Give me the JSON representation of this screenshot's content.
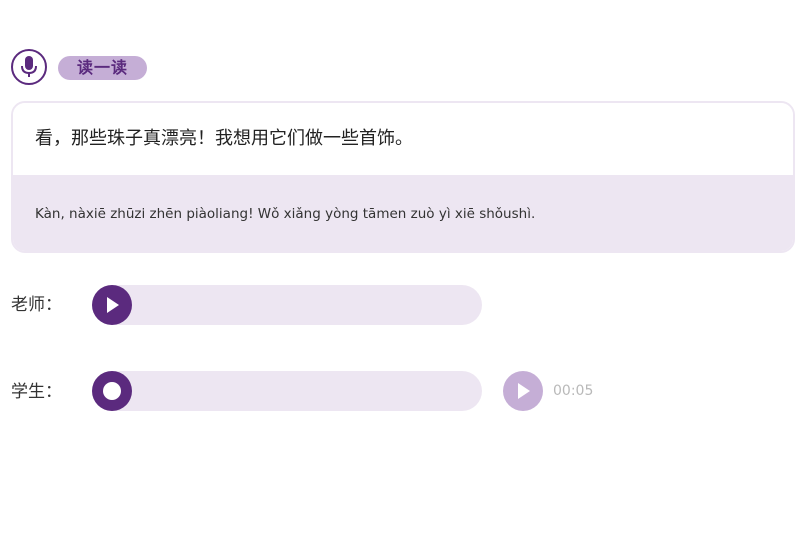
{
  "header": {
    "mic_icon": "microphone-icon",
    "badge_label": "读一读"
  },
  "card": {
    "hanzi": "看，那些珠子真漂亮！我想用它们做一些首饰。",
    "pinyin": "Kàn, nàxiē zhūzi zhēn piàoliang! Wǒ xiǎng yòng tāmen zuò yì xiē shǒushì."
  },
  "teacher": {
    "label": "老师：",
    "play_icon": "play-icon"
  },
  "student": {
    "label": "学生：",
    "record_icon": "record-icon",
    "playback_icon": "play-icon",
    "duration": "00:05"
  },
  "colors": {
    "accent": "#5b2a7e",
    "accent_light": "#c5aed6",
    "track_bg": "#ede6f2"
  }
}
